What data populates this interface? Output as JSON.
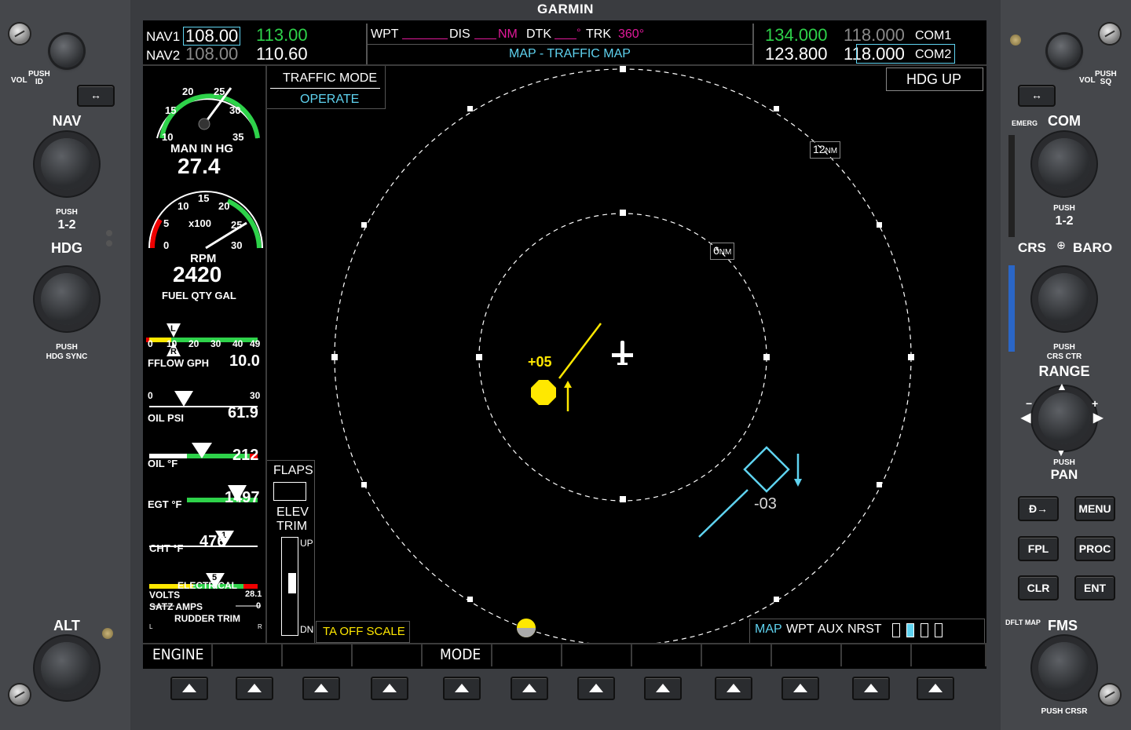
{
  "brand": "GARMIN",
  "nav": {
    "nav1_label": "NAV1",
    "nav1_active": "108.00",
    "nav1_standby": "113.00",
    "nav2_label": "NAV2",
    "nav2_active": "108.00",
    "nav2_standby": "110.60"
  },
  "header": {
    "wpt_label": "WPT",
    "dis_label": "DIS",
    "dis_unit": "NM",
    "dtk_label": "DTK",
    "trk_label": "TRK",
    "trk_value": "360°",
    "page_title": "MAP - TRAFFIC MAP",
    "degree": "°"
  },
  "com": {
    "com1_active": "134.000",
    "com1_standby": "118.000",
    "com1_label": "COM1",
    "com2_active": "123.800",
    "com2_standby": "118.000",
    "com2_label": "COM2"
  },
  "engine": {
    "map_label": "MAN IN HG",
    "map_value": "27.4",
    "map_ticks": [
      "10",
      "15",
      "20",
      "25",
      "30",
      "35"
    ],
    "rpm_label": "RPM",
    "rpm_value": "2420",
    "rpm_mult": "x100",
    "rpm_ticks": [
      "0",
      "5",
      "10",
      "15",
      "20",
      "25",
      "30"
    ],
    "fuel_label": "FUEL QTY GAL",
    "fuel_ticks": [
      "0",
      "10",
      "20",
      "30",
      "40",
      "49"
    ],
    "fuel_left": "L",
    "fuel_right": "R",
    "fflow_label": "FFLOW GPH",
    "fflow_value": "10.0",
    "fflow_ticks": [
      "0",
      "30"
    ],
    "oilpsi_label": "OIL PSI",
    "oilpsi_value": "61.9",
    "oilf_label": "OIL °F",
    "oilf_value": "212",
    "egt_label": "EGT °F",
    "egt_value": "1497",
    "egt_cyl": "1",
    "cht_label": "CHT °F",
    "cht_value": "476",
    "cht_cyl": "5",
    "elec_label": "ELECTRICAL",
    "volts_label": "VOLTS",
    "volts_value": "28.1",
    "amps_label": "SATZ AMPS",
    "amps_value": "0",
    "rudder_label": "RUDDER TRIM",
    "rudder_l": "L",
    "rudder_r": "R",
    "flaps_label": "FLAPS",
    "elev_label": "ELEV",
    "trim_label": "TRIM",
    "trim_up": "UP",
    "trim_dn": "DN"
  },
  "traffic": {
    "mode_title": "TRAFFIC MODE",
    "mode_value": "OPERATE",
    "orientation": "HDG UP",
    "range_outer": "12",
    "range_inner": "6",
    "range_unit": "NM",
    "target1_alt": "+05",
    "target2_alt": "-03",
    "status": "TA OFF SCALE"
  },
  "page_group": {
    "items": [
      "MAP",
      "WPT",
      "AUX",
      "NRST"
    ]
  },
  "softkeys": [
    "ENGINE",
    "",
    "",
    "",
    "MODE",
    "",
    "",
    "",
    "",
    "",
    "",
    ""
  ],
  "left_panel": {
    "vol_label": "VOL",
    "push_id": "PUSH\nID",
    "nav_label": "NAV",
    "push12": "PUSH",
    "one_two": "1-2",
    "hdg_label": "HDG",
    "hdg_sync": "PUSH\nHDG SYNC",
    "alt_label": "ALT"
  },
  "right_panel": {
    "vol_label": "VOL",
    "push_sq": "PUSH\nSQ",
    "emerg": "EMERG",
    "com_label": "COM",
    "push12": "PUSH",
    "one_two": "1-2",
    "crs_label": "CRS",
    "baro_label": "BARO",
    "crs_ctr": "PUSH\nCRS CTR",
    "range_label": "RANGE",
    "push_pan": "PUSH",
    "pan_label": "PAN",
    "menu": "MENU",
    "fpl": "FPL",
    "proc": "PROC",
    "clr": "CLR",
    "ent": "ENT",
    "dflt_map": "DFLT MAP",
    "fms_label": "FMS",
    "push_crsr": "PUSH CRSR"
  }
}
